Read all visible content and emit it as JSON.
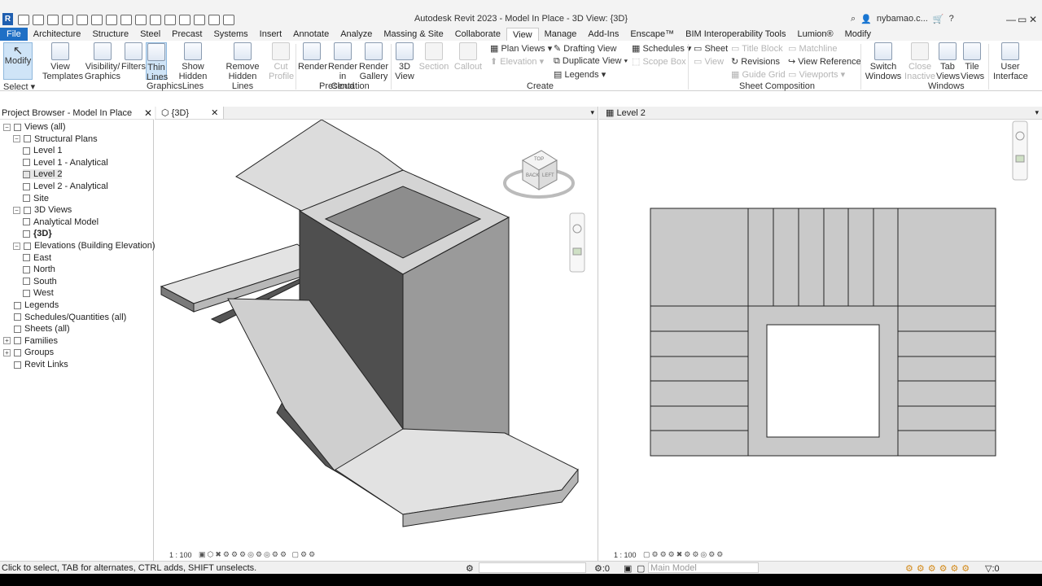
{
  "app": {
    "title": "Autodesk Revit 2023 - Model In Place - 3D View: {3D}",
    "user": "nybamao.c...",
    "logo": "R"
  },
  "tabs": [
    "File",
    "Architecture",
    "Structure",
    "Steel",
    "Precast",
    "Systems",
    "Insert",
    "Annotate",
    "Analyze",
    "Massing & Site",
    "Collaborate",
    "View",
    "Manage",
    "Add-Ins",
    "Enscape™",
    "BIM Interoperability Tools",
    "Lumion®",
    "Modify"
  ],
  "active_tab": "View",
  "ribbon": {
    "modify": "Modify",
    "select": "Select ▾",
    "view_templates": [
      "View",
      "Templates"
    ],
    "visibility": [
      "Visibility/",
      "Graphics"
    ],
    "filters": "Filters",
    "thin_lines": [
      "Thin",
      "Lines"
    ],
    "show_hidden": [
      "Show",
      "Hidden Lines"
    ],
    "remove_hidden": [
      "Remove",
      "Hidden Lines"
    ],
    "cut_profile": [
      "Cut",
      "Profile"
    ],
    "render": "Render",
    "render_cloud": [
      "Render",
      "in Cloud"
    ],
    "render_gallery": [
      "Render",
      "Gallery"
    ],
    "view_3d": [
      "3D",
      "View"
    ],
    "section": "Section",
    "callout": "Callout",
    "plan_views": "Plan Views ▾",
    "elevation": "Elevation ▾",
    "drafting_view": "Drafting View",
    "duplicate_view": "Duplicate View ▾",
    "legends": "Legends ▾",
    "schedules": "Schedules ▾",
    "scope_box": "Scope Box",
    "sheet": "Sheet",
    "view": "View",
    "title_block": "Title Block",
    "revisions": "Revisions",
    "guide_grid": "Guide Grid",
    "matchline": "Matchline",
    "view_reference": "View Reference",
    "viewports": "Viewports ▾",
    "switch_windows": [
      "Switch",
      "Windows"
    ],
    "close_inactive": [
      "Close",
      "Inactive"
    ],
    "tab_views": [
      "Tab",
      "Views"
    ],
    "tile_views": [
      "Tile",
      "Views"
    ],
    "user_interface": [
      "User",
      "Interface"
    ],
    "panels": {
      "select": "Select",
      "graphics": "Graphics",
      "presentation": "Presentation",
      "create": "Create",
      "sheet_composition": "Sheet Composition",
      "windows": "Windows"
    }
  },
  "browser": {
    "title": "Project Browser - Model In Place",
    "items": [
      {
        "label": "Views (all)",
        "level": 0,
        "tog": "−"
      },
      {
        "label": "Structural Plans",
        "level": 1,
        "tog": "−"
      },
      {
        "label": "Level 1",
        "level": 2
      },
      {
        "label": "Level 1 - Analytical",
        "level": 2
      },
      {
        "label": "Level 2",
        "level": 2,
        "selected": true
      },
      {
        "label": "Level 2 - Analytical",
        "level": 2
      },
      {
        "label": "Site",
        "level": 2
      },
      {
        "label": "3D Views",
        "level": 1,
        "tog": "−"
      },
      {
        "label": "Analytical Model",
        "level": 2
      },
      {
        "label": "{3D}",
        "level": 2,
        "bold": true
      },
      {
        "label": "Elevations (Building Elevation)",
        "level": 1,
        "tog": "−"
      },
      {
        "label": "East",
        "level": 2
      },
      {
        "label": "North",
        "level": 2
      },
      {
        "label": "South",
        "level": 2
      },
      {
        "label": "West",
        "level": 2
      },
      {
        "label": "Legends",
        "level": 0
      },
      {
        "label": "Schedules/Quantities (all)",
        "level": 0
      },
      {
        "label": "Sheets (all)",
        "level": 0
      },
      {
        "label": "Families",
        "level": 0,
        "tog": "+"
      },
      {
        "label": "Groups",
        "level": 0,
        "tog": "+"
      },
      {
        "label": "Revit Links",
        "level": 0
      }
    ]
  },
  "views": {
    "left_tab": "{3D}",
    "right_tab": "Level 2",
    "scale_left": "1 : 100",
    "scale_right": "1 : 100",
    "viewcube_left": "LEFT",
    "viewcube_back": "BACK",
    "viewcube_top": "TOP"
  },
  "status": {
    "text": "Click to select, TAB for alternates, CTRL adds, SHIFT unselects.",
    "counter": ":0",
    "model": "Main Model",
    "filter_count": ":0"
  }
}
